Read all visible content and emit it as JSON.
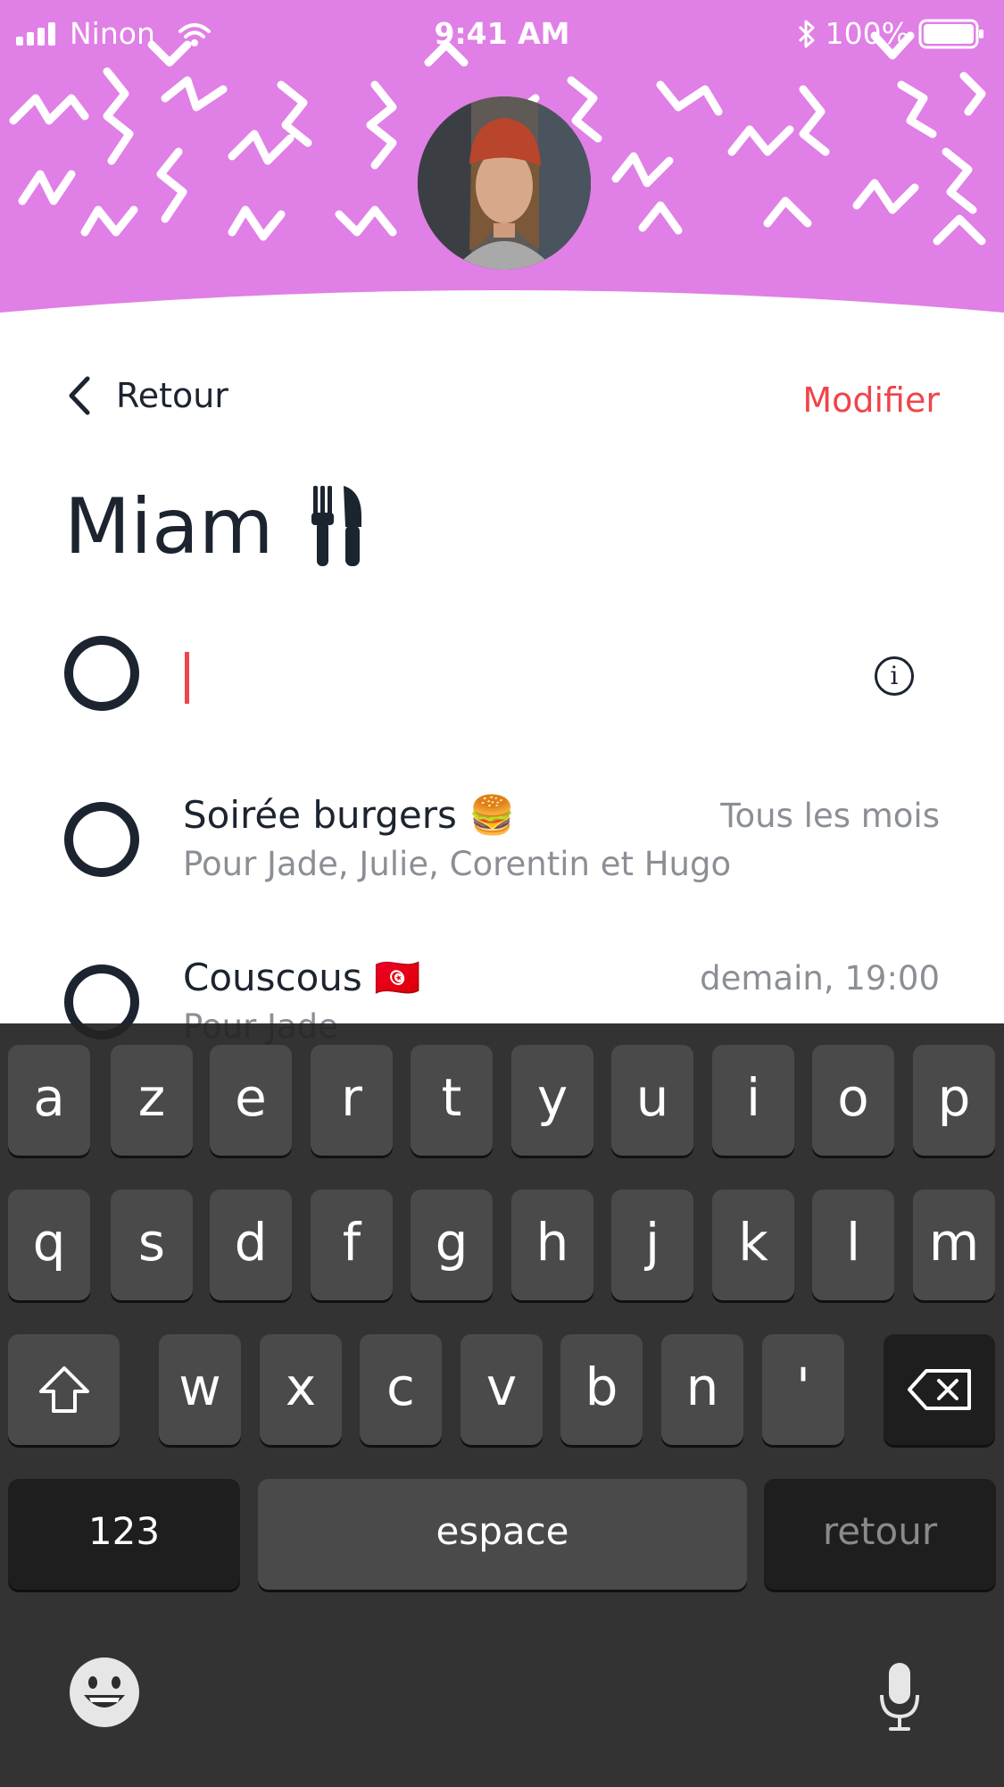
{
  "status_bar": {
    "carrier": "Ninon",
    "time": "9:41 AM",
    "battery": "100%"
  },
  "nav": {
    "back_label": "Retour",
    "modify_label": "Modifier"
  },
  "list": {
    "title": "Miam",
    "title_icon": "fork-knife-icon",
    "items": [
      {
        "title": "Soirée burgers 🍔",
        "subtitle": "Pour Jade, Julie, Corentin et Hugo",
        "date": "Tous les mois"
      },
      {
        "title": "Couscous 🇹🇳",
        "subtitle": "Pour Jade",
        "date": "demain, 19:00"
      }
    ]
  },
  "keyboard": {
    "row1": [
      "a",
      "z",
      "e",
      "r",
      "t",
      "y",
      "u",
      "i",
      "o",
      "p"
    ],
    "row2": [
      "q",
      "s",
      "d",
      "f",
      "g",
      "h",
      "j",
      "k",
      "l",
      "m"
    ],
    "row3": [
      "w",
      "x",
      "c",
      "v",
      "b",
      "n",
      "'"
    ],
    "numbers_label": "123",
    "space_label": "espace",
    "return_label": "retour"
  },
  "colors": {
    "header_bg": "#e07fe6",
    "accent": "#f0444b",
    "text": "#1c2430",
    "muted": "#8b8f95"
  }
}
